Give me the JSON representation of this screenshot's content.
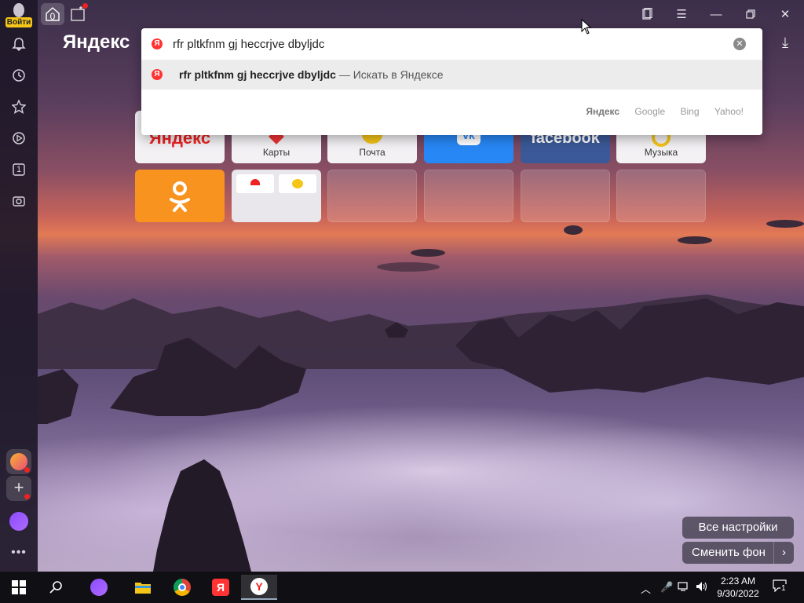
{
  "sidebar": {
    "login_label": "Войти",
    "tab_counter": "1"
  },
  "topbar": {
    "tabs_count": "0"
  },
  "brand": "Яндекс",
  "omnibox": {
    "query": "rfr pltkfnm gj heccrjve dbyljdc",
    "suggestion_bold": "rfr pltkfnm gj heccrjve dbyljdc",
    "suggestion_rest": " — Искать в Яндексе",
    "engines": [
      "Яндекс",
      "Google",
      "Bing",
      "Yahoo!"
    ]
  },
  "tiles": {
    "yandex": "Яндекс",
    "maps": "Карты",
    "mail": "Почта",
    "facebook": "facebook",
    "music": "Музыка"
  },
  "bottom_buttons": {
    "all_settings": "Все настройки",
    "change_bg": "Сменить фон"
  },
  "taskbar": {
    "time": "2:23 AM",
    "date": "9/30/2022",
    "notifications": "1"
  }
}
